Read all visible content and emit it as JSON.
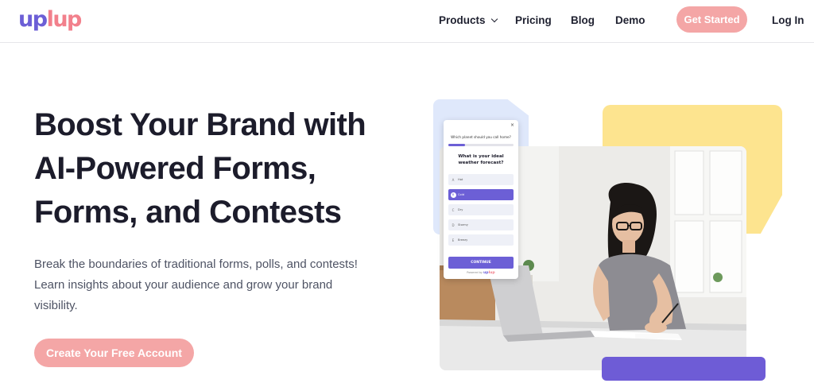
{
  "brand": {
    "logo_part1": "up",
    "logo_part2": "lup"
  },
  "nav": {
    "items": [
      {
        "label": "Products"
      },
      {
        "label": "Pricing"
      },
      {
        "label": "Blog"
      },
      {
        "label": "Demo"
      }
    ],
    "cta_label": "Get Started",
    "login_label": "Log In"
  },
  "hero": {
    "title_lines": [
      "Boost Your Brand with",
      "AI-Powered Forms,",
      "Forms, and Contests"
    ],
    "subtitle": "Break the boundaries of traditional forms, polls, and contests! Learn insights about your audience and grow your brand visibility.",
    "cta_label": "Create Your Free Account"
  },
  "quiz": {
    "close": "×",
    "prev_question": "Which planet should you call home?",
    "progress": 0.25,
    "question": "What is your ideal weather forecast?",
    "options": [
      {
        "key": "A",
        "label": "Hot"
      },
      {
        "key": "B",
        "label": "Cold"
      },
      {
        "key": "C",
        "label": "Dry"
      },
      {
        "key": "D",
        "label": "Stormy"
      },
      {
        "key": "E",
        "label": "Breezy"
      }
    ],
    "selected_index": 1,
    "continue_label": "CONTINUE",
    "powered_by": "Powered by",
    "powered_logo_1": "up",
    "powered_logo_2": "lup"
  },
  "colors": {
    "brand_purple": "#6c5fd6",
    "brand_pink": "#f2808c",
    "cta_pink": "#f4a6a6",
    "deco_yellow": "#fde48f",
    "deco_blue": "#dfe8fb"
  },
  "icons": {
    "products_dropdown": "chevron-down-icon",
    "quiz_close": "close-icon"
  }
}
